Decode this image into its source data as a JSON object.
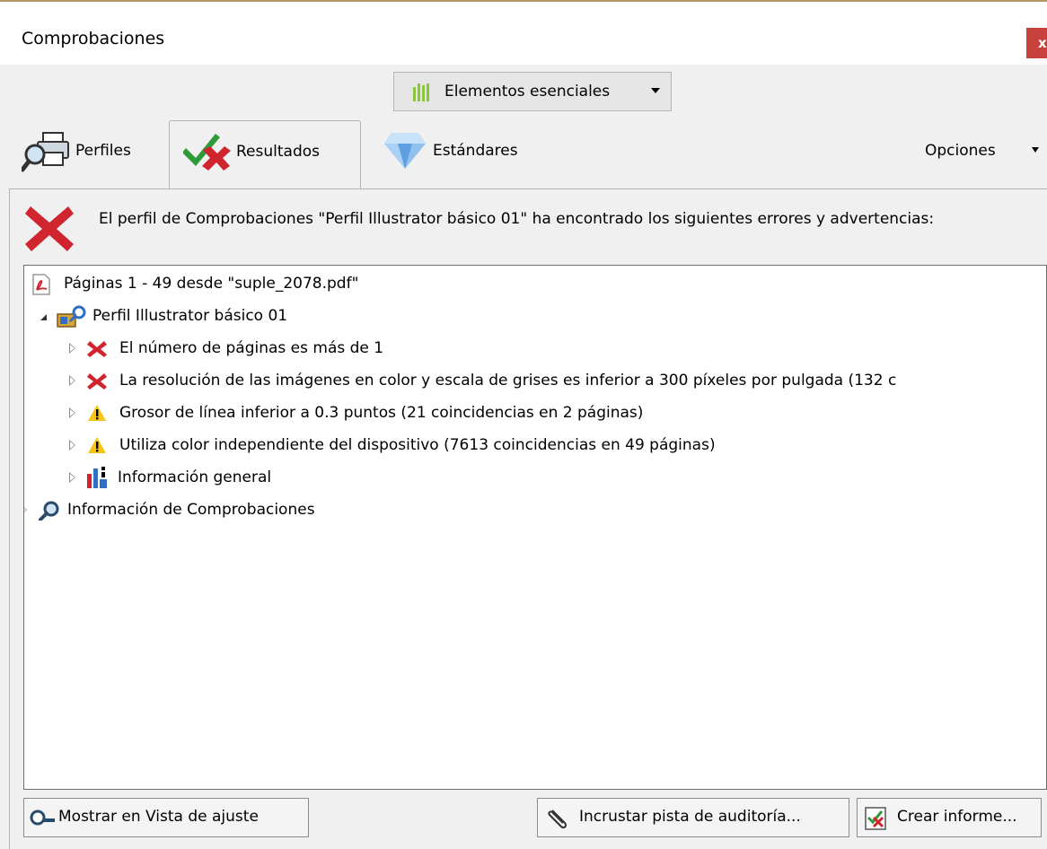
{
  "window": {
    "title": "Comprobaciones",
    "close_glyph": "x"
  },
  "toolbar": {
    "essentials_label": "Elementos esenciales",
    "essentials_icon": "bars-icon"
  },
  "tabs": [
    {
      "label": "Perfiles",
      "icon": "printer-magnifier-icon",
      "active": false
    },
    {
      "label": "Resultados",
      "icon": "check-cross-icon",
      "active": true
    },
    {
      "label": "Estándares",
      "icon": "diamond-icon",
      "active": false
    }
  ],
  "options_label": "Opciones",
  "status": {
    "icon": "error-x-icon",
    "message": "El perfil de Comprobaciones \"Perfil Illustrator básico 01\" ha encontrado los siguientes errores y advertencias:"
  },
  "tree": {
    "root": {
      "label": "Páginas 1 - 49 desde \"suple_2078.pdf\"",
      "icon": "pdf-icon"
    },
    "profile": {
      "label": "Perfil Illustrator básico 01",
      "icon": "profile-icon",
      "expanded": true
    },
    "items": [
      {
        "label": "El número de páginas es más de 1",
        "icon": "error-icon"
      },
      {
        "label": "La resolución de las imágenes en color y escala de grises es inferior a 300 píxeles por pulgada (132 c",
        "icon": "error-icon"
      },
      {
        "label": "Grosor de línea inferior a 0.3 puntos (21 coincidencias en 2 páginas)",
        "icon": "warning-icon"
      },
      {
        "label": "Utiliza color independiente del dispositivo (7613 coincidencias en 49 páginas)",
        "icon": "warning-icon"
      },
      {
        "label": "Información general",
        "icon": "info-chart-icon"
      }
    ],
    "info": {
      "label": "Información de Comprobaciones",
      "icon": "magnifier-icon"
    }
  },
  "buttons": {
    "show_fixup": "Mostrar en Vista de ajuste",
    "embed_audit": "Incrustar pista de auditoría...",
    "create_report": "Crear informe..."
  },
  "colors": {
    "error": "#d0242e",
    "warning": "#f5c518",
    "close_bg": "#c9413d",
    "accent_green": "#2e9a3a"
  }
}
